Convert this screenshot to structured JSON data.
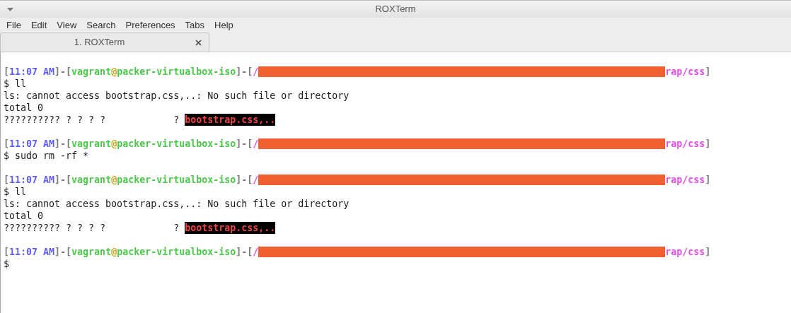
{
  "window": {
    "title": "ROXTerm"
  },
  "menu": [
    "File",
    "Edit",
    "View",
    "Search",
    "Preferences",
    "Tabs",
    "Help"
  ],
  "tabs": [
    {
      "label": "1. ROXTerm",
      "selected": true
    }
  ],
  "terminal": {
    "lines": [
      {
        "kind": "segments",
        "segments": [
          {
            "kind": "text",
            "text": "[",
            "color": "#7a7a7a"
          },
          {
            "kind": "text",
            "text": "11:07 AM",
            "color": "#5c5cff"
          },
          {
            "kind": "text",
            "text": "]-[",
            "color": "#7a7a7a"
          },
          {
            "kind": "text",
            "text": "vagrant",
            "color": "#4cc94c"
          },
          {
            "kind": "text",
            "text": "@",
            "color": "#c9a31a"
          },
          {
            "kind": "text",
            "text": "packer-virtualbox-iso",
            "color": "#4cc94c"
          },
          {
            "kind": "text",
            "text": "]-[",
            "color": "#7a7a7a"
          },
          {
            "kind": "text",
            "text": "/",
            "color": "#e84de8"
          },
          {
            "kind": "redaction"
          },
          {
            "kind": "text",
            "text": "rap/css",
            "color": "#e84de8"
          },
          {
            "kind": "text",
            "text": "]",
            "color": "#7a7a7a"
          }
        ]
      },
      {
        "kind": "plain",
        "text": "$ ll"
      },
      {
        "kind": "plain",
        "text": "ls: cannot access bootstrap.css,..: No such file or directory"
      },
      {
        "kind": "plain",
        "text": "total 0"
      },
      {
        "kind": "listing",
        "text": "?????????? ? ? ? ?            ?",
        "file": "bootstrap.css,.."
      },
      {
        "kind": "blank"
      },
      {
        "kind": "segments",
        "segments": [
          {
            "kind": "text",
            "text": "[",
            "color": "#7a7a7a"
          },
          {
            "kind": "text",
            "text": "11:07 AM",
            "color": "#5c5cff"
          },
          {
            "kind": "text",
            "text": "]-[",
            "color": "#7a7a7a"
          },
          {
            "kind": "text",
            "text": "vagrant",
            "color": "#4cc94c"
          },
          {
            "kind": "text",
            "text": "@",
            "color": "#c9a31a"
          },
          {
            "kind": "text",
            "text": "packer-virtualbox-iso",
            "color": "#4cc94c"
          },
          {
            "kind": "text",
            "text": "]-[",
            "color": "#7a7a7a"
          },
          {
            "kind": "text",
            "text": "/",
            "color": "#e84de8"
          },
          {
            "kind": "redaction"
          },
          {
            "kind": "text",
            "text": "rap/css",
            "color": "#e84de8"
          },
          {
            "kind": "text",
            "text": "]",
            "color": "#7a7a7a"
          }
        ]
      },
      {
        "kind": "plain",
        "text": "$ sudo rm -rf *"
      },
      {
        "kind": "blank"
      },
      {
        "kind": "segments",
        "segments": [
          {
            "kind": "text",
            "text": "[",
            "color": "#7a7a7a"
          },
          {
            "kind": "text",
            "text": "11:07 AM",
            "color": "#5c5cff"
          },
          {
            "kind": "text",
            "text": "]-[",
            "color": "#7a7a7a"
          },
          {
            "kind": "text",
            "text": "vagrant",
            "color": "#4cc94c"
          },
          {
            "kind": "text",
            "text": "@",
            "color": "#c9a31a"
          },
          {
            "kind": "text",
            "text": "packer-virtualbox-iso",
            "color": "#4cc94c"
          },
          {
            "kind": "text",
            "text": "]-[",
            "color": "#7a7a7a"
          },
          {
            "kind": "text",
            "text": "/",
            "color": "#e84de8"
          },
          {
            "kind": "redaction"
          },
          {
            "kind": "text",
            "text": "rap/css",
            "color": "#e84de8"
          },
          {
            "kind": "text",
            "text": "]",
            "color": "#7a7a7a"
          }
        ]
      },
      {
        "kind": "plain",
        "text": "$ ll"
      },
      {
        "kind": "plain",
        "text": "ls: cannot access bootstrap.css,..: No such file or directory"
      },
      {
        "kind": "plain",
        "text": "total 0"
      },
      {
        "kind": "listing",
        "text": "?????????? ? ? ? ?            ?",
        "file": "bootstrap.css,.."
      },
      {
        "kind": "blank"
      },
      {
        "kind": "segments",
        "segments": [
          {
            "kind": "text",
            "text": "[",
            "color": "#7a7a7a"
          },
          {
            "kind": "text",
            "text": "11:07 AM",
            "color": "#5c5cff"
          },
          {
            "kind": "text",
            "text": "]-[",
            "color": "#7a7a7a"
          },
          {
            "kind": "text",
            "text": "vagrant",
            "color": "#4cc94c"
          },
          {
            "kind": "text",
            "text": "@",
            "color": "#c9a31a"
          },
          {
            "kind": "text",
            "text": "packer-virtualbox-iso",
            "color": "#4cc94c"
          },
          {
            "kind": "text",
            "text": "]-[",
            "color": "#7a7a7a"
          },
          {
            "kind": "text",
            "text": "/",
            "color": "#e84de8"
          },
          {
            "kind": "redaction"
          },
          {
            "kind": "text",
            "text": "rap/css",
            "color": "#e84de8"
          },
          {
            "kind": "text",
            "text": "]",
            "color": "#7a7a7a"
          }
        ]
      },
      {
        "kind": "plain",
        "text": "$"
      }
    ]
  }
}
